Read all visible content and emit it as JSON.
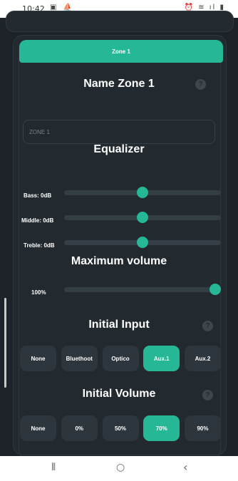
{
  "status_bar": {
    "time": "10:42",
    "left_icons": "▣ ⛵",
    "right_icons": "⏰ ≋ ıl ▮"
  },
  "zone": {
    "header_label": "Zone 1",
    "name_title": "Name Zone 1",
    "name_placeholder": "ZONE 1",
    "help_glyph": "?"
  },
  "equalizer": {
    "title": "Equalizer",
    "bands": [
      {
        "label": "Bass: 0dB",
        "value_fraction": 0.5
      },
      {
        "label": "Middle: 0dB",
        "value_fraction": 0.5
      },
      {
        "label": "Treble: 0dB",
        "value_fraction": 0.5
      }
    ]
  },
  "max_volume": {
    "title": "Maximum volume",
    "label": "100%",
    "value_fraction": 1.0
  },
  "initial_input": {
    "title": "Initial Input",
    "options": [
      "None",
      "Bluethoot",
      "Optico",
      "Aux.1",
      "Aux.2"
    ],
    "selected": "Aux.1"
  },
  "initial_volume": {
    "title": "Initial Volume",
    "options": [
      "None",
      "0%",
      "50%",
      "70%",
      "90%"
    ],
    "selected": "70%"
  },
  "nav": {
    "recents_glyph": "⦀",
    "home_glyph": "○",
    "back_glyph": "‹"
  },
  "colors": {
    "accent": "#26b896",
    "background": "#1d2328",
    "card": "#222a2f",
    "button": "#2d363c",
    "track": "#343e45"
  }
}
